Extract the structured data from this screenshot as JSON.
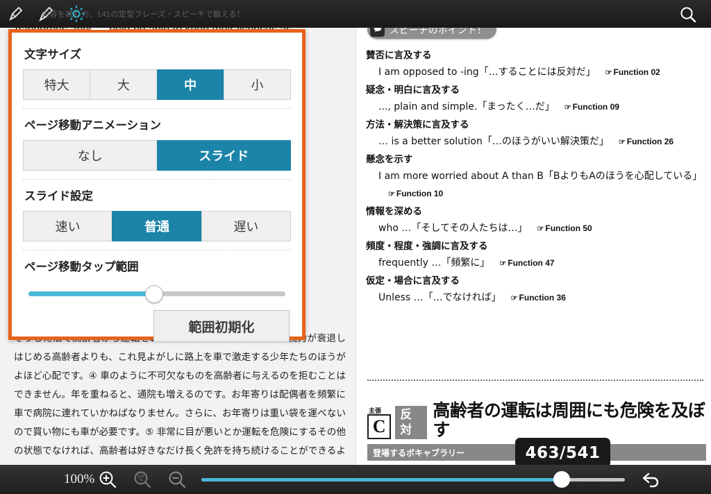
{
  "topbar": {
    "meta_text": "内容を読む力、141の定型フレーズ・スピーチで鍛える！",
    "icons": {
      "pen_left": "pen-nib-icon",
      "pen_right": "marker-pen-icon",
      "gear": "gear-icon",
      "search": "search-icon"
    }
  },
  "left_page": {
    "english_line": "dangerous, they should be able to keep their licenses as",
    "japanese_body": "そうした法で高齢者から運転を奪うべきでしょうか。③ 徐々に視力が衰退しはじめる高齢者よりも、これ見よがしに路上を車で激走する少年たちのほうがよほど心配です。④ 車のように不可欠なものを高齢者に与えるのを拒むことはできません。年を重ねると、通院も増えるのです。お年寄りは配偶者を頻繁に車で病院に連れていかねばなりません。さらに、お年寄りは重い袋を運べないので買い物にも車が必要です。⑤ 非常に目が悪いとか運転を危険にするその他の状態でなければ、高齢者は好きなだけ長く免許を持ち続けることができるようにすべきなのです。"
  },
  "settings": {
    "accent_color": "#1b84a8",
    "border_color": "#e8621a",
    "sections": [
      {
        "label": "文字サイズ",
        "options": [
          "特大",
          "大",
          "中",
          "小"
        ],
        "selected": "中"
      },
      {
        "label": "ページ移動アニメーション",
        "options": [
          "なし",
          "スライド"
        ],
        "selected": "スライド"
      },
      {
        "label": "スライド設定",
        "options": [
          "速い",
          "普通",
          "遅い"
        ],
        "selected": "普通"
      }
    ],
    "tap_range": {
      "label": "ページ移動タップ範囲",
      "value_percent": 49,
      "reset_label": "範囲初期化"
    }
  },
  "right_page": {
    "badge": {
      "label": "スピーチのポイント！",
      "icon": "speech-bubble-icon"
    },
    "points": [
      {
        "head": "賛否に言及する",
        "body": "I am opposed to -ing「…することには反対だ」",
        "function": "Function 02"
      },
      {
        "head": "疑念・明白に言及する",
        "body": "..., plain and simple.「まったく…だ」",
        "function": "Function 09"
      },
      {
        "head": "方法・解決策に言及する",
        "body": "… is a better solution「…のほうがいい解決策だ」",
        "function": "Function 26"
      },
      {
        "head": "懸念を示す",
        "body": "I am more worried about A than B「BよりもAのほうを心配している」",
        "function": "Function 10"
      },
      {
        "head": "情報を深める",
        "body": "who …「そしてその人たちは…」",
        "function": "Function 50"
      },
      {
        "head": "頻度・程度・強調に言及する",
        "body": "frequently …「頻繁に」",
        "function": "Function 47"
      },
      {
        "head": "仮定・場合に言及する",
        "body": "Unless …「…でなければ」",
        "function": "Function 36"
      }
    ],
    "claim": {
      "superscript": "主張",
      "letter": "C",
      "tag": "反対",
      "title": "高齢者の運転は周囲にも危険を及ぼす",
      "vocab_label": "登場するボキャブラリー",
      "counter": "463/541"
    }
  },
  "bottombar": {
    "zoom_percent": "100%",
    "icons": {
      "zoom_in": "zoom-in-icon",
      "zoom_reset": "zoom-reset-100-icon",
      "zoom_out": "zoom-out-icon",
      "undo": "undo-icon"
    },
    "progress_percent": 85
  }
}
